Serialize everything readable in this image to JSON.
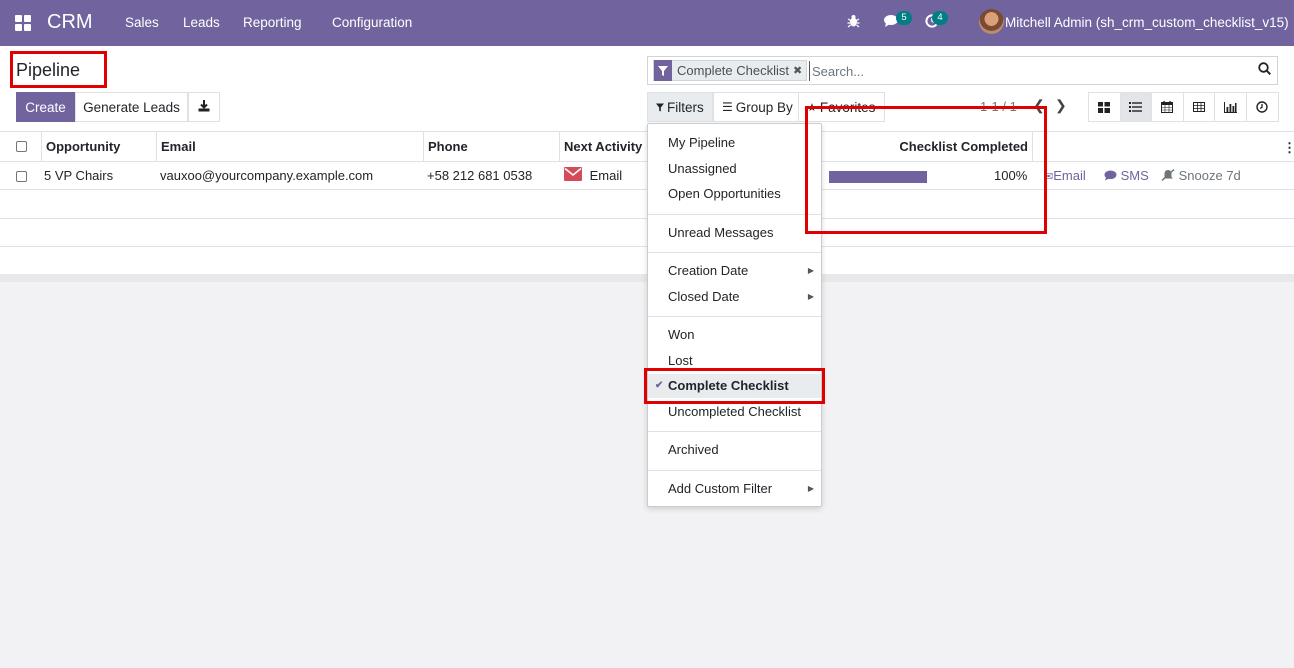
{
  "navbar": {
    "app_name": "CRM",
    "menu": [
      "Sales",
      "Leads",
      "Reporting",
      "Configuration"
    ],
    "messages_count": "5",
    "activities_count": "4",
    "user": "Mitchell Admin (sh_crm_custom_checklist_v15)"
  },
  "page": {
    "title": "Pipeline",
    "create_label": "Create",
    "generate_leads_label": "Generate Leads"
  },
  "search": {
    "facet_label": "Complete Checklist",
    "placeholder": "Search...",
    "filters_label": "Filters",
    "group_by_label": "Group By",
    "favorites_label": "Favorites",
    "pager": "1-1 / 1"
  },
  "table": {
    "columns": [
      "Opportunity",
      "Email",
      "Phone",
      "Next Activity",
      "Checklist Completed"
    ],
    "rows": [
      {
        "opportunity": "5 VP Chairs",
        "email": "vauxoo@yourcompany.example.com",
        "phone": "+58 212 681 0538",
        "next_activity": "Email",
        "checklist_completed": "100%",
        "checklist_fraction": 1.0,
        "action_email": "Email",
        "action_sms": "SMS",
        "action_snooze": "Snooze 7d"
      }
    ]
  },
  "filters_menu": {
    "items": [
      "My Pipeline",
      "Unassigned",
      "Open Opportunities",
      "Unread Messages",
      "Creation Date",
      "Closed Date",
      "Won",
      "Lost",
      "Complete Checklist",
      "Uncompleted Checklist",
      "Archived",
      "Add Custom Filter"
    ],
    "selected": "Complete Checklist"
  },
  "colors": {
    "brand": "#71639e",
    "badge": "#017e84",
    "highlight": "#e00000",
    "email_activity": "#d44c59"
  }
}
